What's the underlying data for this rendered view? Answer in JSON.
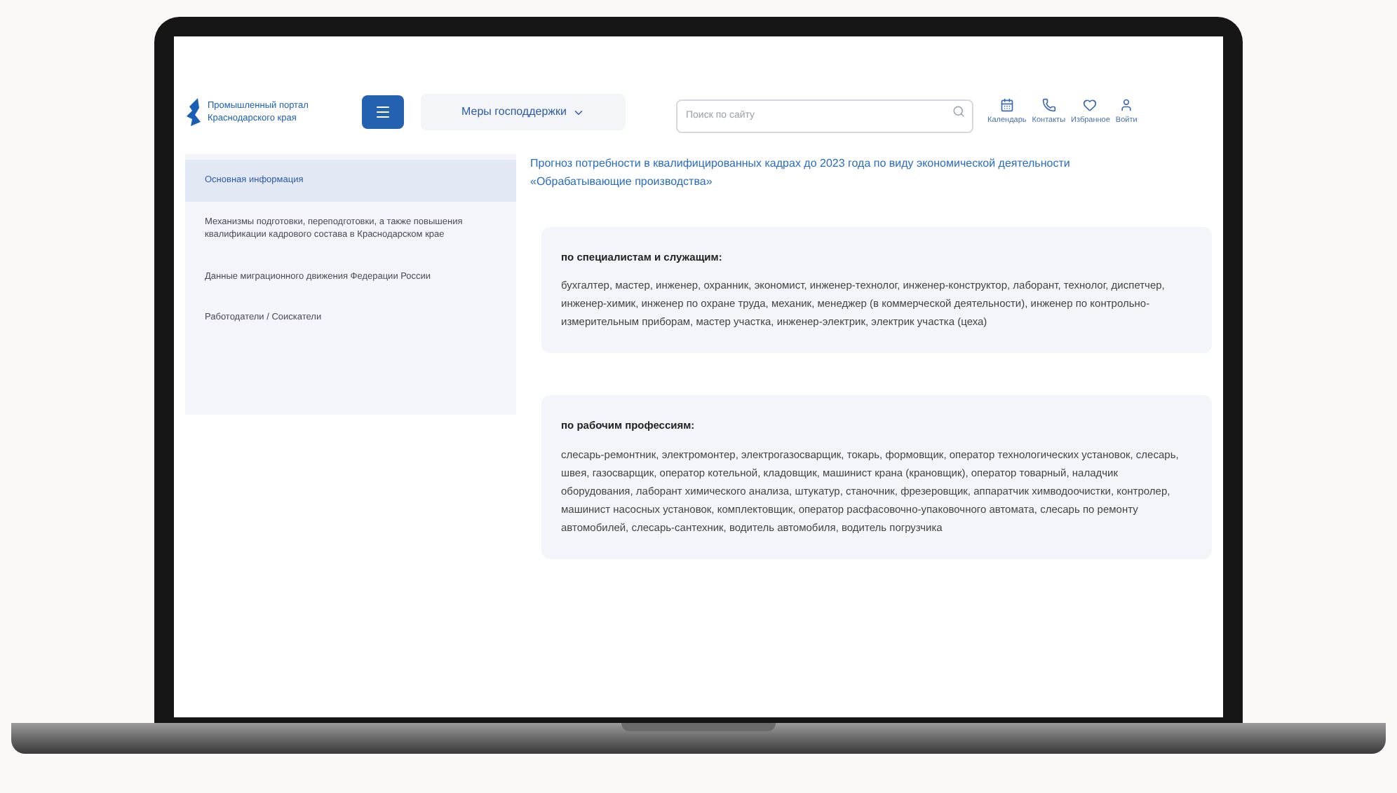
{
  "header": {
    "logo_text": "Промышленный портал Краснодарского края",
    "nav_dropdown": "Меры господдержки",
    "search": {
      "placeholder": "Поиск по сайту"
    },
    "actions": [
      {
        "kind": "calendar",
        "label": "Календарь"
      },
      {
        "kind": "phone",
        "label": "Контакты"
      },
      {
        "kind": "heart",
        "label": "Избранное"
      },
      {
        "kind": "user",
        "label": "Войти"
      }
    ]
  },
  "sidebar": {
    "items": [
      {
        "label": "Основная информация",
        "selected": true
      },
      {
        "label": "Механизмы подготовки, переподготовки, а также повышения квалификации кадрового состава в Краснодарском крае",
        "selected": false
      },
      {
        "label": "Данные миграционного движения Федерации России",
        "selected": false
      },
      {
        "label": "Работодатели / Соискатели",
        "selected": false
      }
    ]
  },
  "content": {
    "title": "Прогноз потребности в квалифицированных кадрах до 2023 года по виду экономической деятельности «Обрабатывающие производства»",
    "cards": [
      {
        "heading": "по специалистам и служащим:",
        "text": "бухгалтер, мастер, инженер, охранник, экономист, инженер-технолог, инженер-конструктор, лаборант, технолог, диспетчер, инженер-химик, инженер по охране труда, механик, менеджер (в коммерческой деятельности), инженер по контрольно-измерительным приборам, мастер участка, инженер-электрик, электрик участка (цеха)"
      },
      {
        "heading": "по рабочим профессиям:",
        "text": "слесарь-ремонтник, электромонтер, электрогазосварщик, токарь, формовщик, оператор технологических установок, слесарь, швея, газосварщик, оператор котельной, кладовщик, машинист крана (крановщик), оператор товарный, наладчик оборудования, лаборант химического анализа, штукатур, станочник, фрезеровщик, аппаратчик химводоочистки, контролер, машинист насосных установок, комплектовщик, оператор расфасовочно-упаковочного автомата, слесарь по ремонту автомобилей, слесарь-сантехник, водитель автомобиля, водитель погрузчика"
      }
    ]
  }
}
